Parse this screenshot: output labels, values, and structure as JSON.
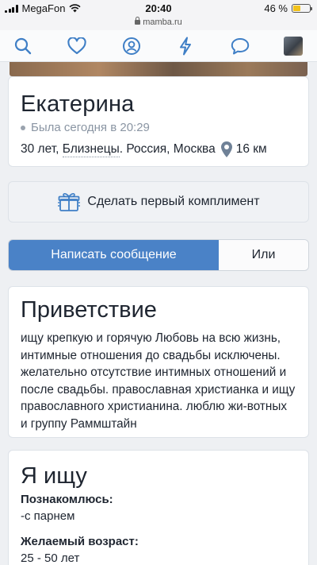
{
  "status_bar": {
    "carrier": "MegaFon",
    "time": "20:40",
    "battery": "46 %",
    "battery_level": 0.46
  },
  "url_bar": {
    "url": "mamba.ru"
  },
  "nav": {
    "icons": [
      "search-icon",
      "heart-icon",
      "radar-icon",
      "lightning-icon",
      "chat-bubble-icon",
      "avatar"
    ]
  },
  "profile": {
    "name": "Екатерина",
    "status": "Была сегодня в 20:29",
    "age": "30 лет,",
    "zodiac": "Близнецы",
    "location": ". Россия, Москва",
    "distance": "16 км"
  },
  "compliment": {
    "label": "Сделать первый комплимент"
  },
  "actions": {
    "write_message": "Написать сообщение",
    "or": "Или"
  },
  "greeting": {
    "title": "Приветствие",
    "text": "ищу крепкую и горячую Любовь на всю жизнь, интимные отношения до свадьбы исключены. желательно отсутствие интимных отношений и после свадьбы. православная христианка и ищу православного христианина. люблю жи-вотных и группу Раммштайн"
  },
  "looking_for": {
    "title": "Я ищу",
    "meet_label": "Познакомлюсь:",
    "meet_value": "-с парнем",
    "age_label": "Желаемый возраст:",
    "age_value": "25 - 50 лет"
  },
  "colors": {
    "accent": "#4a82c7",
    "icon_blue": "#3f7fc6",
    "background": "#eef0f3"
  }
}
